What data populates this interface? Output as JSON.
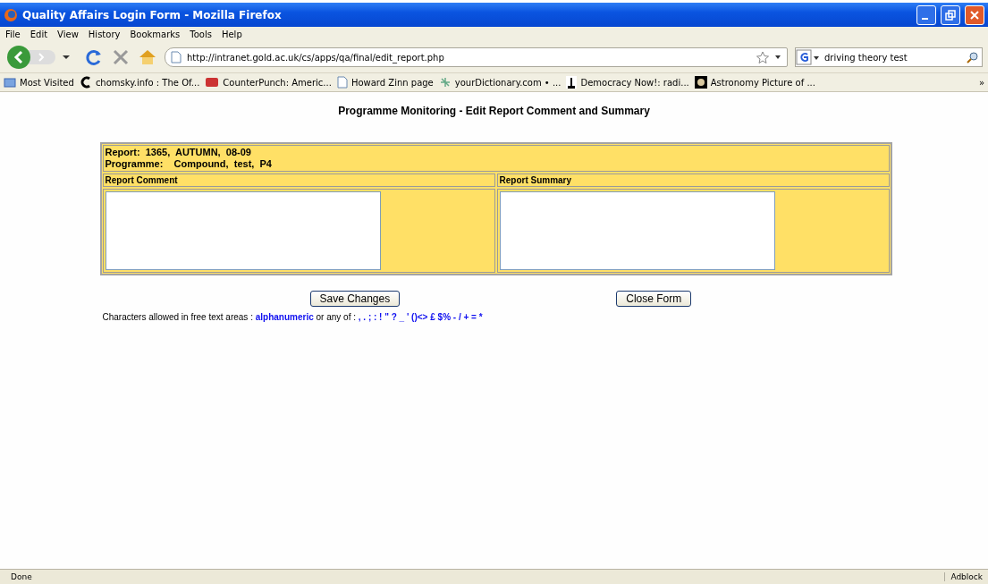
{
  "window": {
    "title": "Quality Affairs Login Form - Mozilla Firefox"
  },
  "menu": [
    "File",
    "Edit",
    "View",
    "History",
    "Bookmarks",
    "Tools",
    "Help"
  ],
  "address": {
    "value": "http://intranet.gold.ac.uk/cs/apps/qa/final/edit_report.php"
  },
  "search": {
    "value": "driving theory test"
  },
  "bookmarks": [
    {
      "label": "Most Visited",
      "kind": "folder"
    },
    {
      "label": "chomsky.info : The Of...",
      "kind": "letter"
    },
    {
      "label": "CounterPunch: Americ...",
      "kind": "cp"
    },
    {
      "label": "Howard Zinn page",
      "kind": "page"
    },
    {
      "label": "yourDictionary.com • ...",
      "kind": "dict"
    },
    {
      "label": "Democracy Now!: radi...",
      "kind": "statue"
    },
    {
      "label": "Astronomy Picture of ...",
      "kind": "planet"
    }
  ],
  "bookmarks_more": "»",
  "page": {
    "heading": "Programme Monitoring - Edit Report Comment and Summary",
    "report_line": "Report:  1365,  AUTUMN,  08-09",
    "programme_line": "Programme:    Compound,  test,  P4",
    "columns": [
      "Report Comment",
      "Report Summary"
    ],
    "buttons": [
      "Save Changes",
      "Close Form"
    ],
    "note": "Characters allowed in free text areas : **alphanumeric** or any of : **, . ; : ! \" ? _ ' ()<> £ $% - / + = ***"
  },
  "status_bar": {
    "text": "Done",
    "addon": "Adblock"
  }
}
